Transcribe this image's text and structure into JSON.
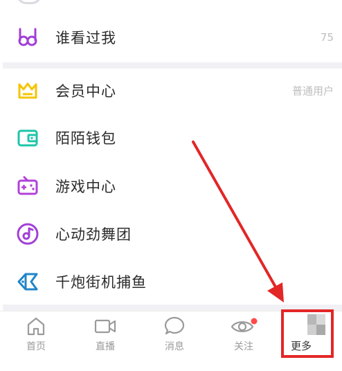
{
  "menu": {
    "visitors": {
      "label": "谁看过我",
      "value": "75",
      "icon": "glasses-icon",
      "color": "#a23fd6"
    },
    "membership": {
      "label": "会员中心",
      "value": "普通用户",
      "icon": "crown-icon",
      "color": "#f5c400"
    },
    "wallet": {
      "label": "陌陌钱包",
      "icon": "wallet-icon",
      "color": "#1fc4a8"
    },
    "games": {
      "label": "游戏中心",
      "icon": "gamepad-icon",
      "color": "#b240d9"
    },
    "dance": {
      "label": "心动劲舞团",
      "icon": "music-disc-icon",
      "color": "#a23fd6"
    },
    "fishing": {
      "label": "千炮街机捕鱼",
      "icon": "fish-icon",
      "color": "#2185c9"
    }
  },
  "tabbar": {
    "home": "首页",
    "live": "直播",
    "messages": "消息",
    "following": "关注",
    "more": "更多"
  },
  "colors": {
    "annotation_red": "#e32626",
    "badge_red": "#ff4a4a",
    "tab_gray": "#9a9a9a"
  }
}
